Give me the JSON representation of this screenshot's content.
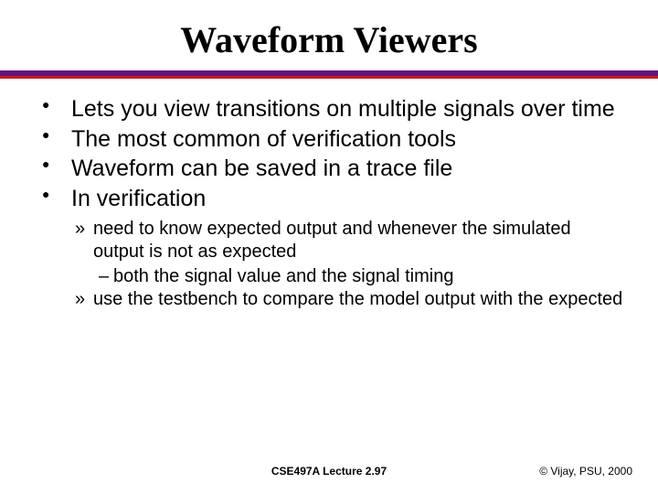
{
  "title": "Waveform Viewers",
  "bullets": [
    "Lets you view transitions on multiple signals over time",
    "The most common of verification tools",
    "Waveform can be saved in a trace file",
    "In verification"
  ],
  "subbullets": [
    "need to know expected output and whenever the simulated output is not as expected",
    "use the testbench to compare the model output with the expected"
  ],
  "dashes": [
    "both the signal value and the signal timing"
  ],
  "footer": {
    "center": "CSE497A Lecture 2.97",
    "right": "© Vijay, PSU, 2000"
  }
}
